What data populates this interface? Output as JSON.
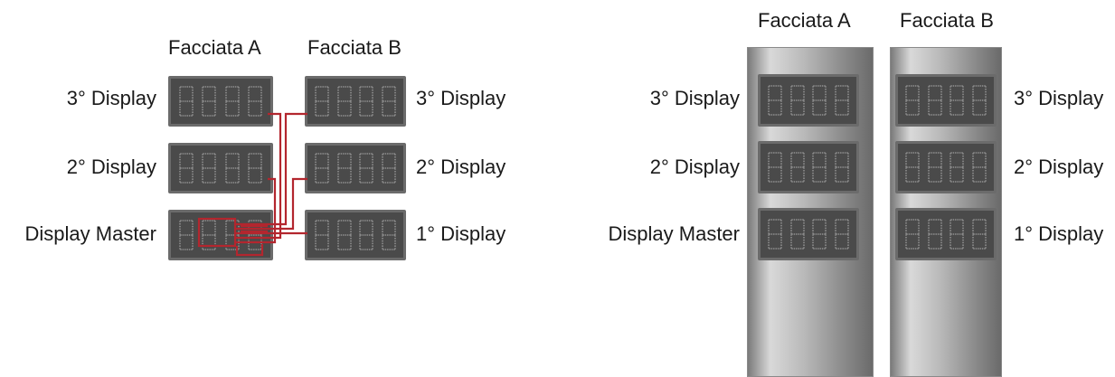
{
  "left_view": {
    "face_a_title": "Facciata A",
    "face_b_title": "Facciata B",
    "face_a_labels": [
      "3° Display",
      "2° Display",
      "Display Master"
    ],
    "face_b_labels": [
      "3° Display",
      "2° Display",
      "1° Display"
    ]
  },
  "right_view": {
    "face_a_title": "Facciata A",
    "face_b_title": "Facciata B",
    "face_a_labels": [
      "3° Display",
      "2° Display",
      "Display Master"
    ],
    "face_b_labels": [
      "3° Display",
      "2° Display",
      "1° Display"
    ]
  },
  "display_digit_count": 4,
  "colors": {
    "display_body": "#4a4a4a",
    "display_frame": "#6b6b6b",
    "segment_dots": "#8e8e8e",
    "wiring": "#b3262e"
  }
}
